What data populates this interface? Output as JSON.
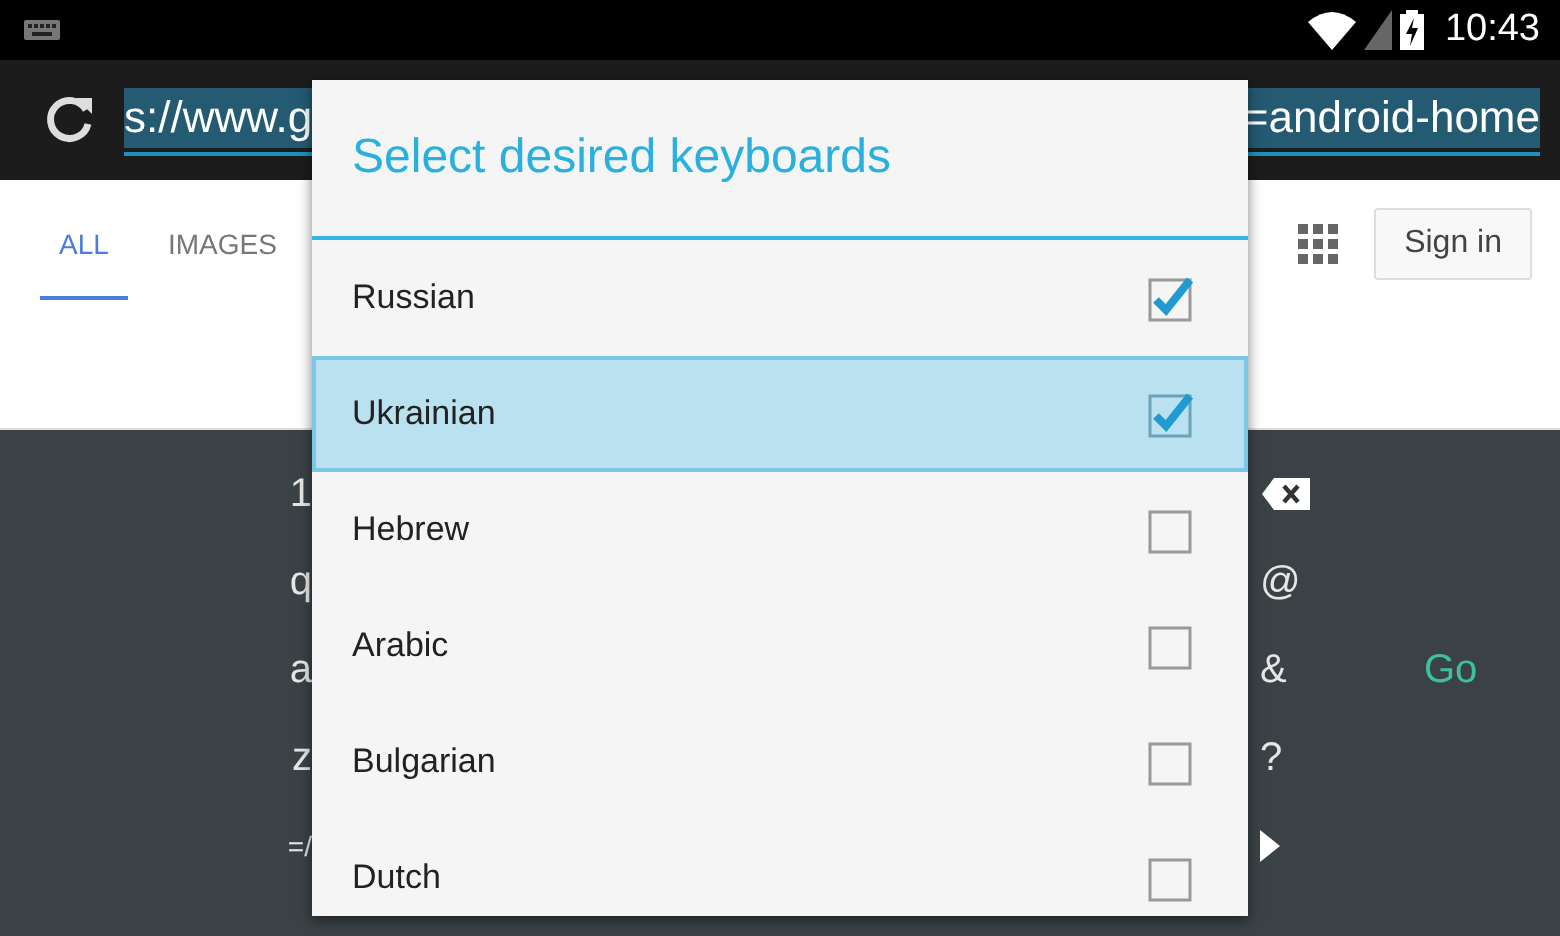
{
  "status_bar": {
    "time": "10:43"
  },
  "address_bar": {
    "url_start": "s://www.g",
    "url_end": "=android-home",
    "selected": true
  },
  "page": {
    "tabs": [
      {
        "label": "ALL",
        "selected": true
      },
      {
        "label": "IMAGES",
        "selected": false
      }
    ],
    "sign_in": "Sign in"
  },
  "keyboard": {
    "left_keys": [
      "1",
      "q",
      "a",
      "z",
      "=/"
    ],
    "right_keys": [
      {
        "kind": "backspace"
      },
      {
        "kind": "char",
        "label": "@"
      },
      {
        "kind": "char",
        "label": "&"
      },
      {
        "kind": "char",
        "label": "?"
      },
      {
        "kind": "arrow"
      }
    ],
    "action": "Go"
  },
  "dialog": {
    "title": "Select desired keyboards",
    "items": [
      {
        "label": "Russian",
        "checked": true,
        "highlighted": false
      },
      {
        "label": "Ukrainian",
        "checked": true,
        "highlighted": true
      },
      {
        "label": "Hebrew",
        "checked": false,
        "highlighted": false
      },
      {
        "label": "Arabic",
        "checked": false,
        "highlighted": false
      },
      {
        "label": "Bulgarian",
        "checked": false,
        "highlighted": false
      },
      {
        "label": "Dutch",
        "checked": false,
        "highlighted": false
      }
    ]
  }
}
